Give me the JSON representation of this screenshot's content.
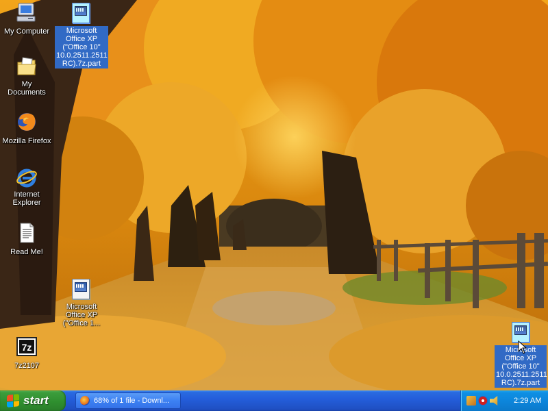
{
  "desktop": {
    "icons": [
      {
        "label": "My Computer",
        "icon": "my-computer-icon"
      },
      {
        "label": "My Documents",
        "icon": "my-documents-icon"
      },
      {
        "label": "Mozilla Firefox",
        "icon": "firefox-icon"
      },
      {
        "label": "Internet Explorer",
        "icon": "internet-explorer-icon"
      },
      {
        "label": "Read Me!",
        "icon": "text-document-icon"
      },
      {
        "label": "7z2107",
        "icon": "7zip-icon"
      },
      {
        "label": "Microsoft Office XP (\"Office 10\" 10.0.2511.2511 RC).7z.part",
        "icon": "archive-file-icon",
        "selected": true
      },
      {
        "label": "Microsoft Office XP (\"Office 1...",
        "icon": "archive-file-icon",
        "selected": false
      },
      {
        "label": "Microsoft Office XP (\"Office 10\" 10.0.2511.2511 RC).7z.part",
        "icon": "archive-file-icon",
        "selected": true
      }
    ]
  },
  "taskbar": {
    "start_label": "start",
    "task_label": "68% of 1 file - Downl...",
    "clock": "2:29 AM"
  },
  "colors": {
    "taskbar_blue": "#245edb",
    "start_green": "#3c9d3c",
    "tray_blue": "#0c86dc",
    "selection_blue": "#316ac5"
  }
}
